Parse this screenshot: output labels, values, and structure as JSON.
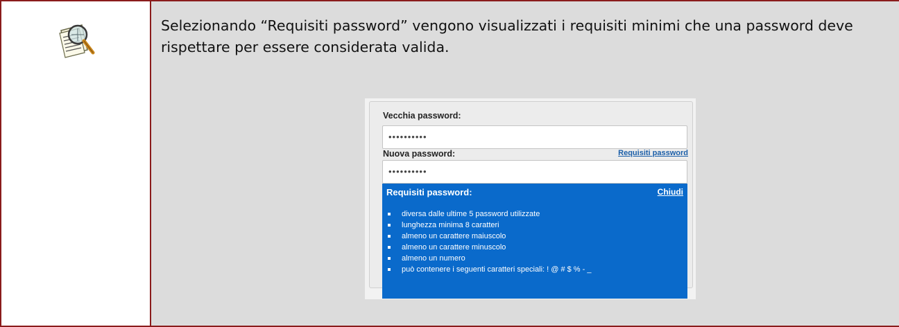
{
  "intro_text": "Selezionando “Requisiti password” vengono visualizzati i requisiti minimi che una password deve rispettare per essere considerata valida.",
  "form": {
    "old_password_label": "Vecchia password:",
    "old_password_value": "••••••••••",
    "new_password_label": "Nuova password:",
    "new_password_value": "••••••••••",
    "requirements_link": "Requisiti password"
  },
  "popup": {
    "title": "Requisiti password:",
    "close_label": "Chiudi",
    "items": [
      "diversa dalle ultime 5 password utilizzate",
      "lunghezza minima 8 caratteri",
      "almeno un carattere maiuscolo",
      "almeno un carattere minuscolo",
      "almeno un numero",
      "può contenere i seguenti caratteri speciali: ! @ # $ % - _"
    ]
  },
  "colors": {
    "border": "#8a1c1c",
    "cell_background": "#dcdcdc",
    "popup_background": "#0a6acb",
    "link": "#1a5ea8"
  },
  "icon": "magnifier-over-document-icon"
}
